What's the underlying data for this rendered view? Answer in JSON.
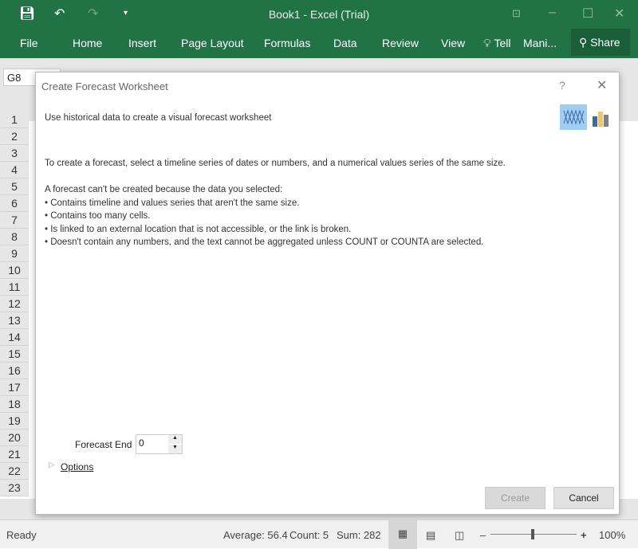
{
  "window": {
    "title": "Book1 - Excel (Trial)"
  },
  "ribbon": {
    "tabs": [
      "File",
      "Home",
      "Insert",
      "Page Layout",
      "Formulas",
      "Data",
      "Review",
      "View",
      "Tell",
      "Mani..."
    ],
    "share": "Share"
  },
  "namebox": "G8",
  "rows": [
    "1",
    "2",
    "3",
    "4",
    "5",
    "6",
    "7",
    "8",
    "9",
    "10",
    "11",
    "12",
    "13",
    "14",
    "15",
    "16",
    "17",
    "18",
    "19",
    "20",
    "21",
    "22",
    "23"
  ],
  "dialog": {
    "title": "Create Forecast Worksheet",
    "help": "?",
    "subtitle": "Use historical data to create a visual forecast worksheet",
    "intro": "To create a forecast, select a timeline series of dates or numbers, and a numerical values series of the same size.",
    "error_head": "A forecast can't be created because the data you selected:",
    "bullets": [
      "• Contains timeline and values series that aren't the same size.",
      "• Contains too many cells.",
      "• Is linked to an external location that is not accessible, or the link is broken.",
      "• Doesn't contain any numbers, and the text cannot be aggregated unless COUNT or COUNTA are selected."
    ],
    "forecast_end_label": "Forecast End",
    "forecast_end_value": "0",
    "options": "Options",
    "create": "Create",
    "cancel": "Cancel"
  },
  "status": {
    "ready": "Ready",
    "average": "Average: 56.4",
    "count": "Count: 5",
    "sum": "Sum: 282",
    "zoom": "100%",
    "zoom_level": 100
  }
}
